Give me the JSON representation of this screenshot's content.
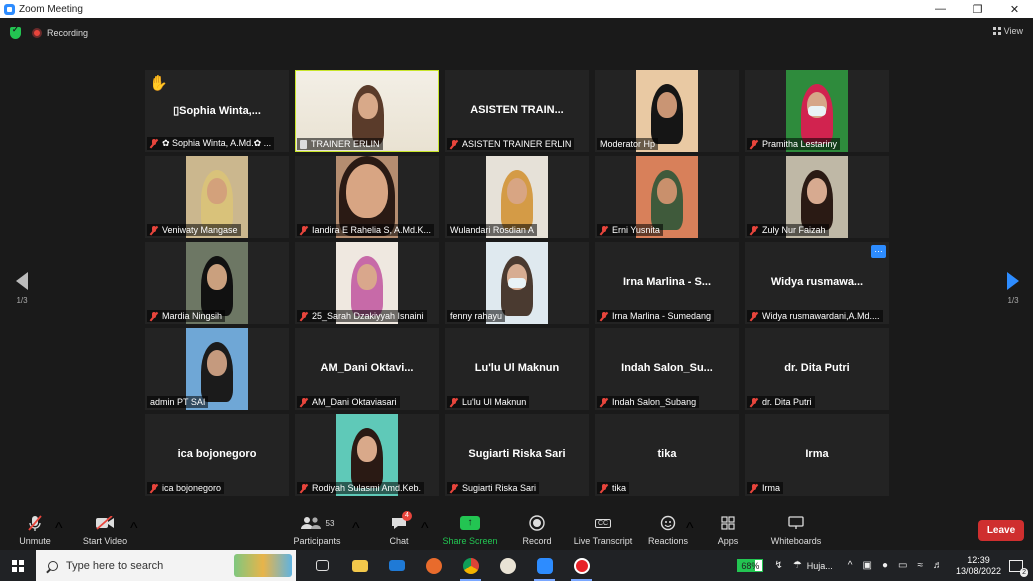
{
  "window": {
    "title": "Zoom Meeting"
  },
  "status": {
    "recording_label": "Recording",
    "view_label": "View"
  },
  "pagination": {
    "left_page": "1/3",
    "right_page": "1/3"
  },
  "tiles": [
    {
      "center_name": "▯Sophia  Winta,...",
      "label": "✿ Sophia Winta, A.Md.✿ ...",
      "has_video": false,
      "muted": true,
      "hand": true
    },
    {
      "center_name": "",
      "label": "TRAINER ERLIN",
      "has_video": true,
      "muted": false,
      "active": true,
      "pinned": true
    },
    {
      "center_name": "ASISTEN  TRAIN...",
      "label": "ASISTEN TRAINER ERLIN",
      "has_video": false,
      "muted": true
    },
    {
      "center_name": "",
      "label": "Moderator Hp",
      "has_video": true,
      "muted": false
    },
    {
      "center_name": "",
      "label": "Pramitha Lestariny",
      "has_video": true,
      "muted": true
    },
    {
      "center_name": "",
      "label": "Veniwaty Mangase",
      "has_video": true,
      "muted": true
    },
    {
      "center_name": "",
      "label": "Iandira E Rahelia S, A.Md.K...",
      "has_video": true,
      "muted": true
    },
    {
      "center_name": "",
      "label": "Wulandari Rosdian A",
      "has_video": true,
      "muted": false
    },
    {
      "center_name": "",
      "label": "Erni Yusnita",
      "has_video": true,
      "muted": true
    },
    {
      "center_name": "",
      "label": "Zuly Nur Faizah",
      "has_video": true,
      "muted": true
    },
    {
      "center_name": "",
      "label": "Mardia Ningsih",
      "has_video": true,
      "muted": true
    },
    {
      "center_name": "",
      "label": "25_Sarah Dzakiyyah Isnaini",
      "has_video": true,
      "muted": true
    },
    {
      "center_name": "",
      "label": "fenny rahayu",
      "has_video": true,
      "muted": false
    },
    {
      "center_name": "Irna  Marlina  -  S...",
      "label": "Irna Marlina - Sumedang",
      "has_video": false,
      "muted": true
    },
    {
      "center_name": "Widya  rusmawa...",
      "label": "Widya rusmawardani,A.Md....",
      "has_video": false,
      "muted": true,
      "dots": true
    },
    {
      "center_name": "",
      "label": "admin PT SAI",
      "has_video": true,
      "muted": false
    },
    {
      "center_name": "AM_Dani  Oktavi...",
      "label": "AM_Dani Oktaviasari",
      "has_video": false,
      "muted": true
    },
    {
      "center_name": "Lu'lu  Ul  Maknun",
      "label": "Lu'lu Ul Maknun",
      "has_video": false,
      "muted": true
    },
    {
      "center_name": "Indah  Salon_Su...",
      "label": "Indah Salon_Subang",
      "has_video": false,
      "muted": true
    },
    {
      "center_name": "dr. Dita Putri",
      "label": "dr. Dita Putri",
      "has_video": false,
      "muted": true
    },
    {
      "center_name": "ica bojonegoro",
      "label": "ica bojonegoro",
      "has_video": false,
      "muted": true
    },
    {
      "center_name": "",
      "label": "Rodiyah Sulasmi Amd.Keb.",
      "has_video": true,
      "muted": true
    },
    {
      "center_name": "Sugiarti Riska Sari",
      "label": "Sugiarti Riska Sari",
      "has_video": false,
      "muted": true
    },
    {
      "center_name": "tika",
      "label": "tika",
      "has_video": false,
      "muted": true
    },
    {
      "center_name": "Irma",
      "label": "Irma",
      "has_video": false,
      "muted": true
    }
  ],
  "toolbar": {
    "unmute": "Unmute",
    "start_video": "Start Video",
    "participants": "Participants",
    "participants_count": "53",
    "chat": "Chat",
    "chat_badge": "4",
    "share_screen": "Share Screen",
    "record": "Record",
    "live_transcript": "Live Transcript",
    "live_transcript_icon": "CC",
    "reactions": "Reactions",
    "apps": "Apps",
    "whiteboards": "Whiteboards",
    "leave": "Leave"
  },
  "taskbar": {
    "search_placeholder": "Type here to search",
    "battery_percent": "68%",
    "battery_level": 0.68,
    "weather": "Huja...",
    "time": "12:39",
    "date": "13/08/2022",
    "notification_count": "2"
  },
  "colors": {
    "accent": "#2d8cff",
    "active_speaker": "#c8e52b",
    "leave": "#cf2f2f",
    "muted": "#e8453c",
    "share": "#23c552"
  }
}
